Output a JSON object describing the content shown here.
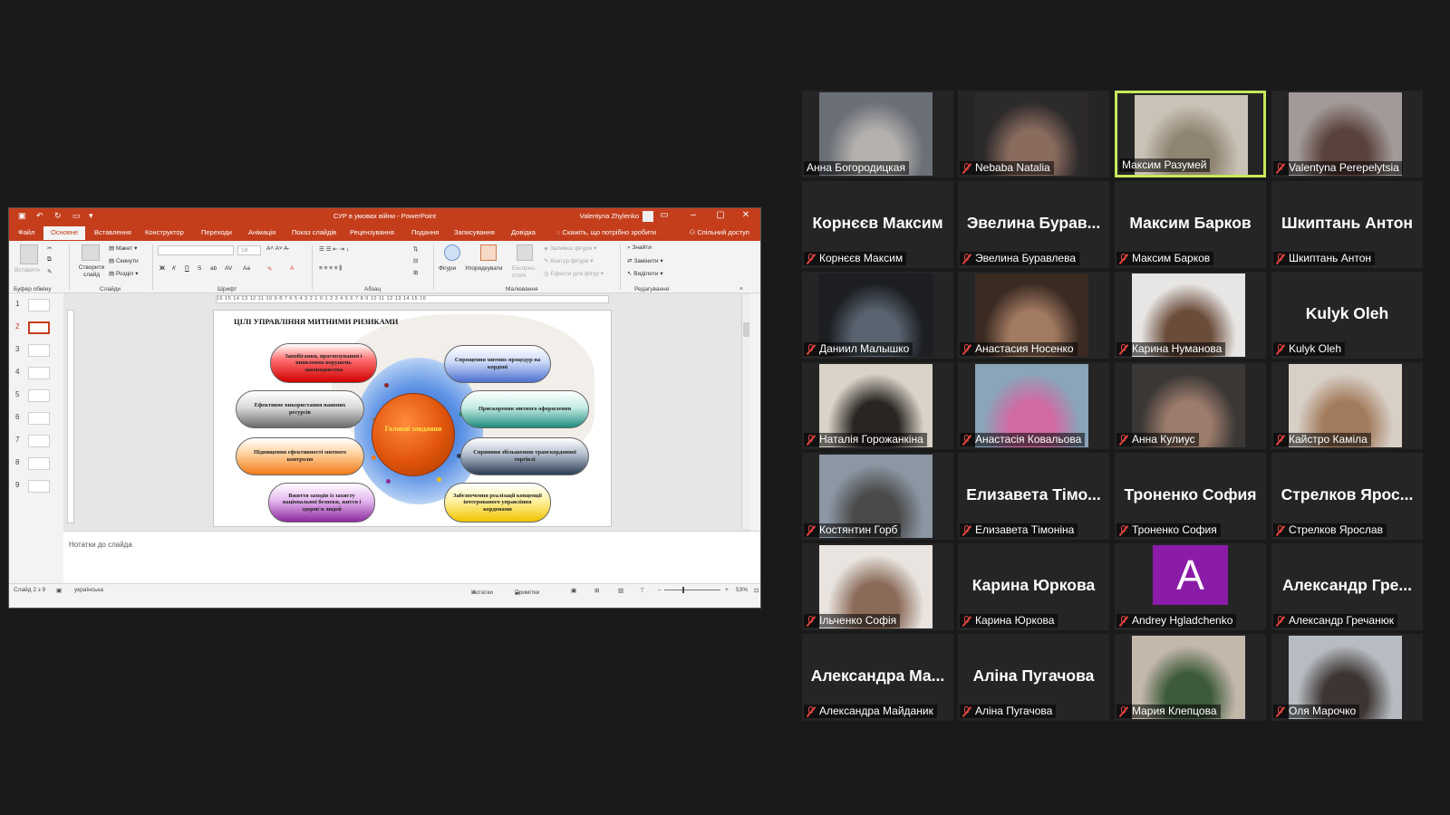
{
  "powerpoint": {
    "window_title": "СУР в умовах війни  -  PowerPoint",
    "user_name": "Valentyna Zhylenko",
    "tabs": [
      "Файл",
      "Основне",
      "Вставлення",
      "Конструктор",
      "Переходи",
      "Анімація",
      "Показ слайдів",
      "Рецензування",
      "Подання",
      "Записування",
      "Довідка"
    ],
    "active_tab": "Основне",
    "tell_me": "Скажіть, що потрібно зробити",
    "share": "Спільний доступ",
    "ribbon": {
      "paste": "Вставити",
      "new_slide": "Створити слайд",
      "layout": "Макет",
      "reset": "Скинути",
      "section": "Розділ",
      "shapes": "Фігури",
      "arrange": "Упорядкувати",
      "quick_styles": "Експрес-стилі",
      "shape_fill": "Заливка фігури",
      "shape_outline": "Контур фігури",
      "shape_effects": "Ефекти для фігур",
      "find": "Знайти",
      "replace": "Замінити",
      "select": "Виділити",
      "font_size": "18",
      "groups": {
        "clipboard": "Буфер обміну",
        "slides": "Слайди",
        "font": "Шрифт",
        "paragraph": "Абзац",
        "drawing": "Малювання",
        "editing": "Редагування"
      }
    },
    "slide_numbers": [
      "1",
      "2",
      "3",
      "4",
      "5",
      "6",
      "7",
      "8",
      "9"
    ],
    "active_slide_index": 2,
    "ruler_text": "16 15 14 13 12 11 10 9 8 7 6 5 4 3 2 1 0 1 2 3 4 5 6 7 8 9 10 11 12 13 14 15 16",
    "slide": {
      "title": "ЦІЛІ УПРАВЛІННЯ МИТНИМИ РИЗИКАМИ",
      "center": "Головні завдання",
      "goals": [
        "Запобігання, прогнозування і виявлення порушень законодавства",
        "Спрощення митних процедур на кордоні",
        "Ефективне використання наявних ресурсів",
        "Прискорення митного оформлення",
        "Підвищення ефективності митного контролю",
        "Сприяння збільшенню транскордонної торгівлі",
        "Вжиття заходів із захисту національної безпеки, життя і здоров'я людей",
        "Забезпечення реалізації концепції інтегрованого управління кордонами"
      ]
    },
    "notes_placeholder": "Нотатки до слайда",
    "status": {
      "slide_counter": "Слайд 2 з 9",
      "language": "українська",
      "notes_btn": "Нотатки",
      "comments_btn": "Примітки",
      "zoom": "53%"
    },
    "colors": {
      "accent": "#c43e1c"
    }
  },
  "gallery": {
    "speaking_color": "#c8e85a",
    "muted_icon": "mic-off-icon",
    "participants": [
      {
        "name": "Анна Богородицкая",
        "video": true,
        "muted": false,
        "bg": [
          "#6b6f78",
          "#b3b0ad"
        ]
      },
      {
        "name": "Nebaba Natalia",
        "video": true,
        "muted": true,
        "bg": [
          "#2d2a2b",
          "#8a6c5f"
        ]
      },
      {
        "name": "Максим Разумей",
        "video": true,
        "muted": false,
        "speaking": true,
        "bg": [
          "#c9c2b6",
          "#8f8472"
        ]
      },
      {
        "name": "Valentyna Perepelytsia",
        "video": true,
        "muted": true,
        "bg": [
          "#a29a98",
          "#5a423c"
        ]
      },
      {
        "name": "Корнєєв Максим",
        "video": false,
        "muted": true
      },
      {
        "name": "Эвелина Буравлева",
        "display": "Эвелина Бурав...",
        "video": false,
        "muted": true
      },
      {
        "name": "Максим Барков",
        "video": false,
        "muted": true
      },
      {
        "name": "Шкиптань Антон",
        "video": false,
        "muted": true
      },
      {
        "name": "Даниил Малышко",
        "video": true,
        "muted": true,
        "bg": [
          "#1c1e22",
          "#5a6470"
        ]
      },
      {
        "name": "Анастасия Носенко",
        "video": true,
        "muted": true,
        "bg": [
          "#3a2a22",
          "#a27a62"
        ]
      },
      {
        "name": "Карина Нуманова",
        "video": true,
        "muted": true,
        "bg": [
          "#e8e6e4",
          "#6a4c3a"
        ]
      },
      {
        "name": "Kulyk Oleh",
        "video": false,
        "muted": true
      },
      {
        "name": "Наталія Горожанкіна",
        "video": true,
        "muted": true,
        "bg": [
          "#d9d3c8",
          "#2a2522"
        ]
      },
      {
        "name": "Анастасія Ковальова",
        "video": true,
        "muted": true,
        "bg": [
          "#8aa4b8",
          "#d26aa4"
        ]
      },
      {
        "name": "Анна Кулиус",
        "video": true,
        "muted": true,
        "bg": [
          "#3b3735",
          "#9c7c6c"
        ]
      },
      {
        "name": "Кайстро Каміла",
        "video": true,
        "muted": true,
        "bg": [
          "#d8cfc6",
          "#a27b5c"
        ]
      },
      {
        "name": "Костянтин Горб",
        "video": true,
        "muted": true,
        "bg": [
          "#8c97a4",
          "#4a4a4a"
        ]
      },
      {
        "name": "Елизавета Тімоніна",
        "display": "Елизавета Тімо...",
        "video": false,
        "muted": true
      },
      {
        "name": "Троненко София",
        "video": false,
        "muted": true
      },
      {
        "name": "Стрелков Ярослав",
        "display": "Стрелков Ярос...",
        "video": false,
        "muted": true
      },
      {
        "name": "Ільченко Софія",
        "video": true,
        "muted": true,
        "bg": [
          "#e9e4df",
          "#8a6a58"
        ]
      },
      {
        "name": "Карина Юркова",
        "video": false,
        "muted": true
      },
      {
        "name": "Andrey Hgladchenko",
        "video": false,
        "letter": "A",
        "muted": true
      },
      {
        "name": "Александр Гречанюк",
        "display": "Александр Гре...",
        "video": false,
        "muted": true
      },
      {
        "name": "Александра Майданик",
        "display": "Александра Ма...",
        "video": false,
        "muted": true
      },
      {
        "name": "Аліна Пугачова",
        "video": false,
        "muted": true
      },
      {
        "name": "Мария Клепцова",
        "video": true,
        "muted": true,
        "bg": [
          "#c4b8ab",
          "#3d5a3a"
        ]
      },
      {
        "name": "Оля Марочко",
        "video": true,
        "muted": true,
        "bg": [
          "#b7bcc2",
          "#3e3533"
        ]
      }
    ]
  }
}
